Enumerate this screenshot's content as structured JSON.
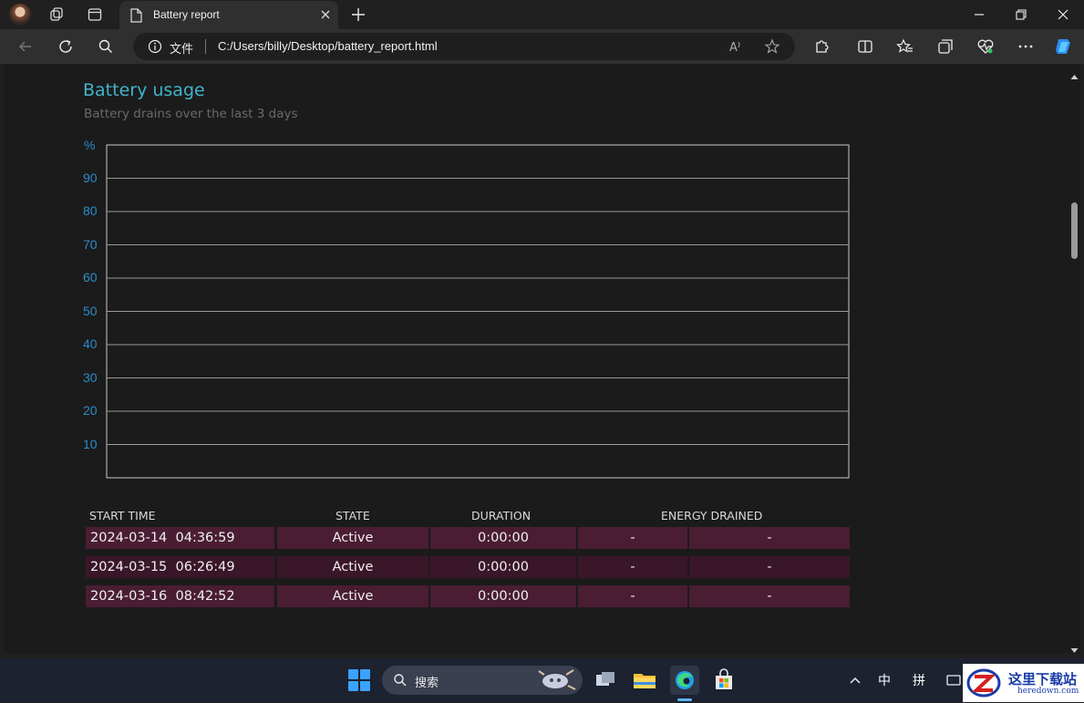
{
  "browser": {
    "tab_title": "Battery report",
    "url_protocol": "文件",
    "url": "C:/Users/billy/Desktop/battery_report.html"
  },
  "report": {
    "title": "Battery usage",
    "subtitle": "Battery drains over the last 3 days"
  },
  "chart_data": {
    "type": "line",
    "ylabel": "%",
    "yticks": [
      "90",
      "80",
      "70",
      "60",
      "50",
      "40",
      "30",
      "20",
      "10"
    ],
    "ylim": [
      0,
      100
    ],
    "grid": true,
    "series": []
  },
  "table": {
    "headers": [
      "START TIME",
      "STATE",
      "DURATION",
      "ENERGY DRAINED"
    ],
    "rows": [
      {
        "date": "2024-03-14",
        "time": "04:36:59",
        "state": "Active",
        "duration": "0:00:00",
        "energy_pct": "-",
        "energy_mwh": "-"
      },
      {
        "date": "2024-03-15",
        "time": "06:26:49",
        "state": "Active",
        "duration": "0:00:00",
        "energy_pct": "-",
        "energy_mwh": "-"
      },
      {
        "date": "2024-03-16",
        "time": "08:42:52",
        "state": "Active",
        "duration": "0:00:00",
        "energy_pct": "-",
        "energy_mwh": "-"
      }
    ]
  },
  "taskbar": {
    "search_label": "搜索",
    "ime_lang": "中",
    "ime_mode": "拼"
  },
  "watermark": {
    "title": "这里下载站",
    "domain": "heredown.com"
  },
  "colors": {
    "accent_title": "#40b4cc",
    "axis_label": "#2b8cc8",
    "row_odd": "#4a1d33",
    "row_even": "#3a1629"
  }
}
